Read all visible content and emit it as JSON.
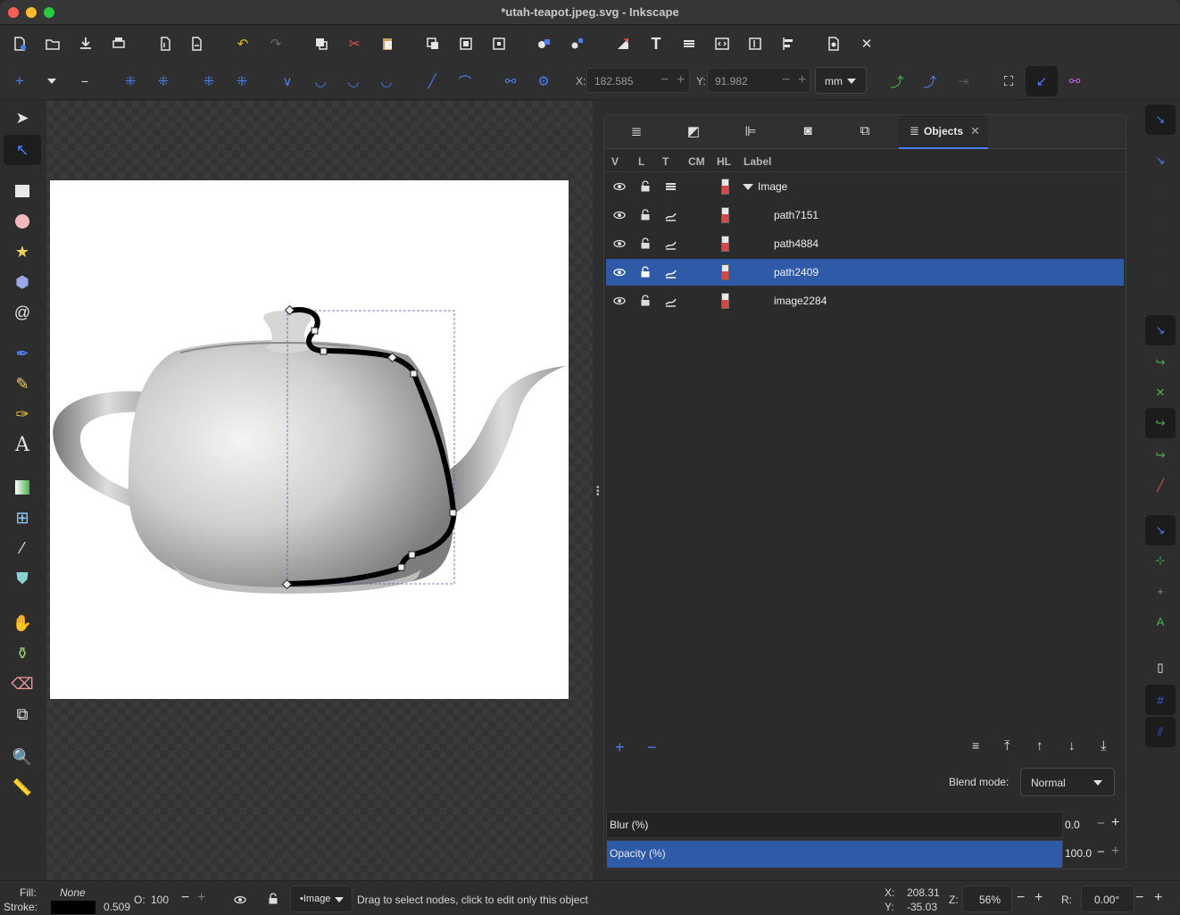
{
  "window": {
    "title": "*utah-teapot.jpeg.svg - Inkscape"
  },
  "controls": {
    "x_label": "X:",
    "x_value": "182.585",
    "y_label": "Y:",
    "y_value": "91.982",
    "unit": "mm"
  },
  "objects_panel": {
    "tab_label": "Objects",
    "columns": [
      "V",
      "L",
      "T",
      "CM",
      "HL",
      "Label"
    ],
    "rows": [
      {
        "label": "Image",
        "selected": false,
        "group": true
      },
      {
        "label": "path7151",
        "selected": false
      },
      {
        "label": "path4884",
        "selected": false
      },
      {
        "label": "path2409",
        "selected": true
      },
      {
        "label": "image2284",
        "selected": false
      }
    ],
    "blend_label": "Blend mode:",
    "blend_value": "Normal",
    "blur_label": "Blur (%)",
    "blur_value": "0.0",
    "opacity_label": "Opacity (%)",
    "opacity_value": "100.0",
    "opacity_level": 1.0
  },
  "status": {
    "fill_label": "Fill:",
    "fill_value": "None",
    "stroke_label": "Stroke:",
    "stroke_width": "0.509",
    "opacity_label": "O:",
    "opacity_value": "100",
    "layer": "•Image",
    "message": "Drag to select nodes, click to edit only this object",
    "cursor_x_label": "X:",
    "cursor_x": "208.31",
    "cursor_y_label": "Y:",
    "cursor_y": "-35.03",
    "zoom_label": "Z:",
    "zoom": "56%",
    "rotation_label": "R:",
    "rotation": "0.00°"
  },
  "colors": {
    "accent": "#4a7cf3",
    "selection": "#2f5aa8"
  }
}
